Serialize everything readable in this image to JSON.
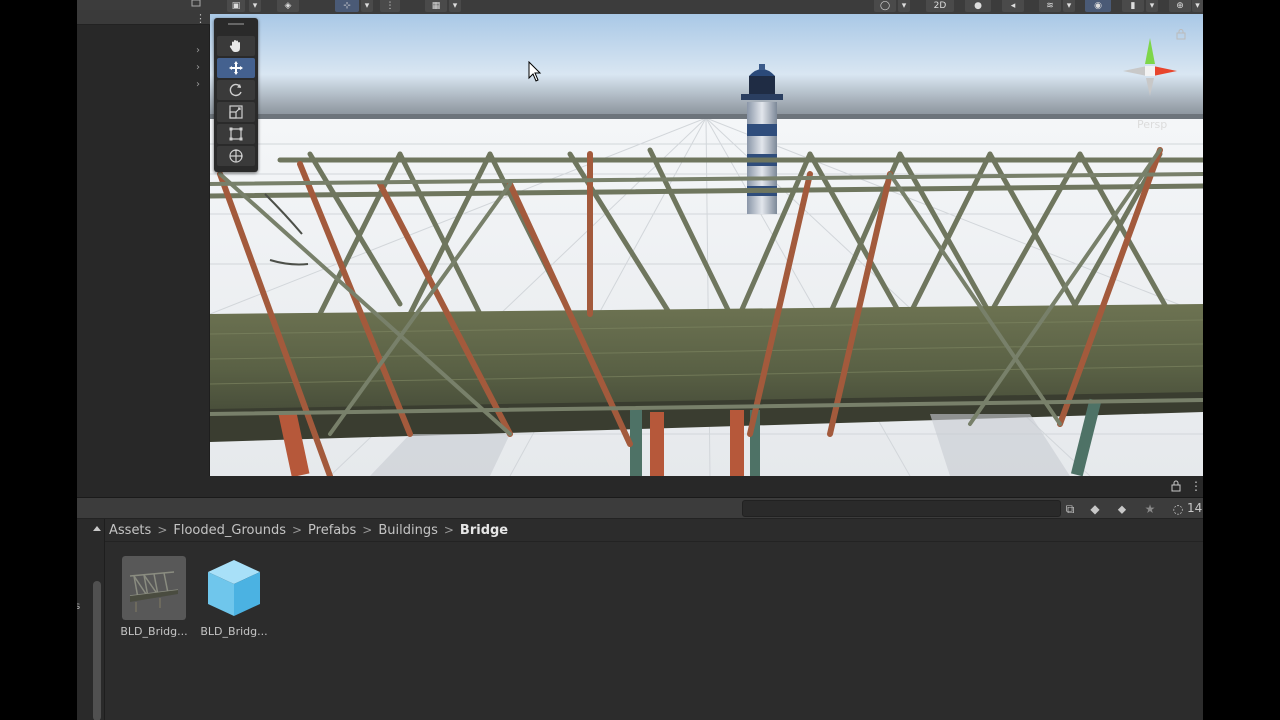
{
  "project": {
    "breadcrumb": [
      {
        "label": "Assets"
      },
      {
        "label": "Flooded_Grounds"
      },
      {
        "label": "Prefabs"
      },
      {
        "label": "Buildings"
      },
      {
        "label": "Bridge"
      }
    ],
    "breadcrumb_separator": ">",
    "search": {
      "value": "",
      "placeholder": ""
    },
    "hidden_packages_count": "14",
    "assets": [
      {
        "label": "BLD_Bridg...",
        "type": "prefab-thumbnail"
      },
      {
        "label": "BLD_Bridg...",
        "type": "model-cube"
      }
    ]
  },
  "scene": {
    "projection_label": "Persp"
  },
  "toolbar": {
    "mode_2d_label": "2D"
  },
  "colors": {
    "accent_active_tool": "#44618f",
    "panel_bg": "#2c2c2c",
    "toolbar_bg": "#3c3c3c",
    "cube_icon": "#6fc6ec",
    "gizmo_y": "#7dd64a",
    "gizmo_x": "#e8452c"
  }
}
